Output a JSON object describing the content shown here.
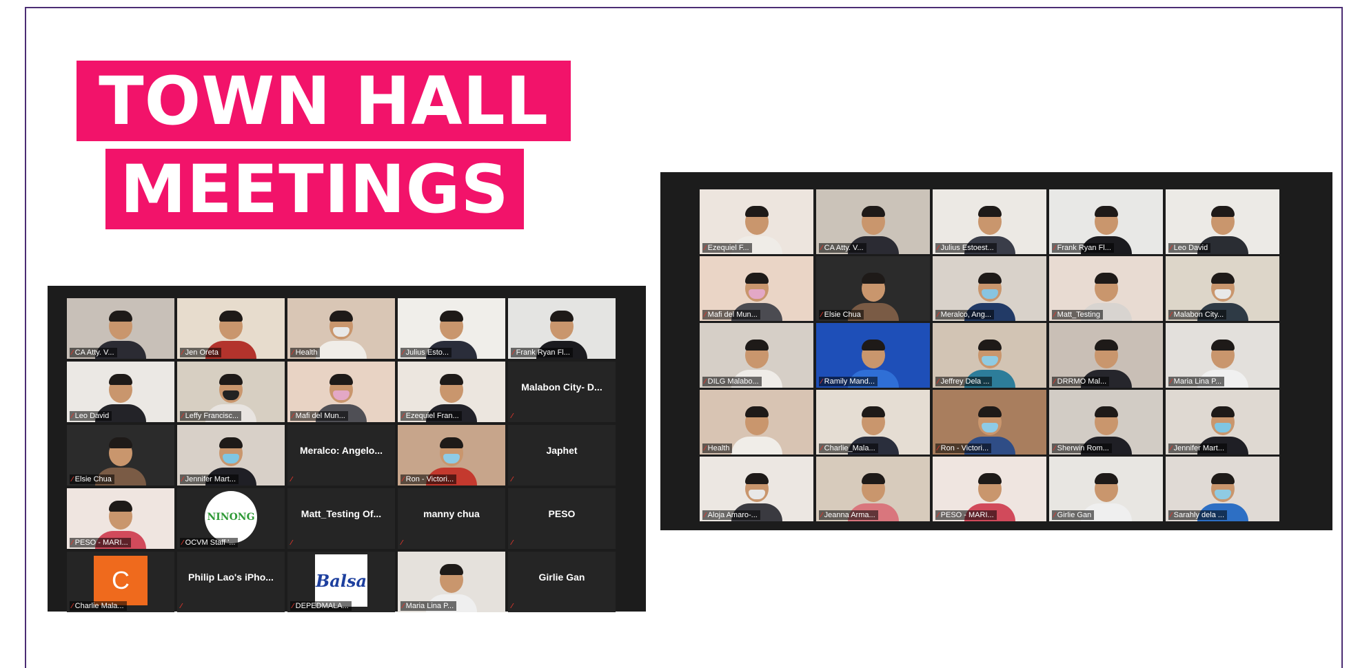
{
  "title": {
    "line1": "TOWN HALL",
    "line2": "MEETINGS"
  },
  "colors": {
    "brand_pink": "#f2136a",
    "frame": "#4b2d73",
    "active_border": "#d6e05a",
    "mic_off": "#e0352b"
  },
  "left_gallery": [
    {
      "name": "CA Atty. V...",
      "kind": "video",
      "bg": "#c8c0b8",
      "shirt": "#2b2b33"
    },
    {
      "name": "Jen Oreta",
      "kind": "video",
      "bg": "#e7dccd",
      "shirt": "#b3332c"
    },
    {
      "name": "Health",
      "kind": "video",
      "bg": "#d9c6b5",
      "shirt": "#f0ede8",
      "mask": "#e8e8e8"
    },
    {
      "name": "Julius Esto...",
      "kind": "video",
      "bg": "#f0eeea",
      "shirt": "#2a2d3a"
    },
    {
      "name": "Frank Ryan Fl...",
      "kind": "video",
      "bg": "#e4e4e2",
      "shirt": "#1b1b1f"
    },
    {
      "name": "Leo David",
      "kind": "video",
      "bg": "#ebe8e4",
      "shirt": "#232328"
    },
    {
      "name": "Leffy Francisc...",
      "kind": "video",
      "bg": "#d7cfc2",
      "shirt": "#e8e4e0",
      "mask": "#222"
    },
    {
      "name": "Mafi del Mun...",
      "kind": "video",
      "bg": "#e8d3c4",
      "shirt": "#4f4f55",
      "mask": "#e3a8c6"
    },
    {
      "name": "Ezequiel Fran...",
      "kind": "video",
      "bg": "#ece6df",
      "shirt": "#222229"
    },
    {
      "name": "Malabon City- D...",
      "kind": "text"
    },
    {
      "name": "Elsie Chua",
      "kind": "video",
      "bg": "#2b2b2b",
      "shirt": "#7a5b45",
      "active": true
    },
    {
      "name": "Jennifer Mart...",
      "kind": "video",
      "bg": "#d8d0c8",
      "shirt": "#1f1f25",
      "mask": "#7fc6e3"
    },
    {
      "name": "Meralco: Angelo...",
      "kind": "text"
    },
    {
      "name": "Ron - Victori...",
      "kind": "video",
      "bg": "#c7a58b",
      "shirt": "#c4392e",
      "mask": "#8ecbe6"
    },
    {
      "name": "Japhet",
      "kind": "text"
    },
    {
      "name": "PESO - MARI...",
      "kind": "video",
      "bg": "#efe5e0",
      "shirt": "#d14a5b"
    },
    {
      "name": "OCVM Staff '...",
      "kind": "logo",
      "logo_text": "NINONG",
      "logo_color": "#2f9a37"
    },
    {
      "name": "Matt_Testing Of...",
      "kind": "text"
    },
    {
      "name": "manny chua",
      "kind": "text"
    },
    {
      "name": "PESO",
      "kind": "text"
    },
    {
      "name": "Charlie Mala...",
      "kind": "avatar",
      "letter": "C"
    },
    {
      "name": "Philip Lao's iPho...",
      "kind": "text"
    },
    {
      "name": "DEPEDMALA...",
      "kind": "logo",
      "logo_text": "Balsa",
      "logo_color": "#1d3f9e"
    },
    {
      "name": "Maria Lina P...",
      "kind": "video",
      "bg": "#e5e1dc",
      "shirt": "#efefef"
    },
    {
      "name": "Girlie Gan",
      "kind": "text"
    }
  ],
  "right_gallery": [
    {
      "name": "Ezequiel F...",
      "kind": "video",
      "bg": "#ede5de",
      "shirt": "#efece7"
    },
    {
      "name": "CA Atty. V...",
      "kind": "video",
      "bg": "#cbc3b9",
      "shirt": "#2b2b33"
    },
    {
      "name": "Julius Estoest...",
      "kind": "video",
      "bg": "#ece9e4",
      "shirt": "#3a3d49",
      "active": true
    },
    {
      "name": "Frank Ryan Fl...",
      "kind": "video",
      "bg": "#e8e8e6",
      "shirt": "#1b1b1f"
    },
    {
      "name": "Leo David",
      "kind": "video",
      "bg": "#eceae6",
      "shirt": "#2a2d33"
    },
    {
      "name": "Mafi del Mun...",
      "kind": "video",
      "bg": "#ead5c6",
      "shirt": "#4b4b51",
      "mask": "#e3a8c6"
    },
    {
      "name": "Elsie Chua",
      "kind": "video",
      "bg": "#2b2b2b",
      "shirt": "#7a5b45"
    },
    {
      "name": "Meralco, Ang...",
      "kind": "video",
      "bg": "#d9d2ca",
      "shirt": "#223a66",
      "mask": "#88c4e0"
    },
    {
      "name": "Matt_Testing",
      "kind": "video",
      "bg": "#e8dbd2",
      "shirt": "#d8d4d0"
    },
    {
      "name": "Malabon City...",
      "kind": "video",
      "bg": "#ddd6c9",
      "shirt": "#2e3a45",
      "mask": "#e8e8e8"
    },
    {
      "name": "DILG Malabo...",
      "kind": "video",
      "bg": "#d6cfc7",
      "shirt": "#efece8"
    },
    {
      "name": "Ramily Mand...",
      "kind": "video",
      "bg": "#1e4fb8",
      "shirt": "#2f6fd6"
    },
    {
      "name": "Jeffrey Dela ...",
      "kind": "video",
      "bg": "#d2c4b4",
      "shirt": "#2d7d9a",
      "mask": "#8fcbe3"
    },
    {
      "name": "DRRMO Mal...",
      "kind": "video",
      "bg": "#c9bfb6",
      "shirt": "#26262c"
    },
    {
      "name": "Maria Lina P...",
      "kind": "video",
      "bg": "#e3e0dc",
      "shirt": "#f0f0f0"
    },
    {
      "name": "Health",
      "kind": "video",
      "bg": "#d8c4b3",
      "shirt": "#f0ede8"
    },
    {
      "name": "Charlie_Mala...",
      "kind": "video",
      "bg": "#e5ddd3",
      "shirt": "#2a2e3c"
    },
    {
      "name": "Ron - Victori...",
      "kind": "video",
      "bg": "#a97e5e",
      "shirt": "#2f4d86",
      "mask": "#8ecbe6"
    },
    {
      "name": "Sherwin Rom...",
      "kind": "video",
      "bg": "#d2ccc5",
      "shirt": "#1f1f25"
    },
    {
      "name": "Jennifer Mart...",
      "kind": "video",
      "bg": "#dfd9d2",
      "shirt": "#1f1f25",
      "mask": "#7fc6e3"
    },
    {
      "name": "Aloja Amaro-...",
      "kind": "video",
      "bg": "#ece7e2",
      "shirt": "#3a3a40",
      "mask": "#e8e8e8"
    },
    {
      "name": "Jeanna Arma...",
      "kind": "video",
      "bg": "#d7cbbc",
      "shirt": "#d9767d"
    },
    {
      "name": "PESO - MARI...",
      "kind": "video",
      "bg": "#efe5e0",
      "shirt": "#d14a5b"
    },
    {
      "name": "Girlie Gan",
      "kind": "video",
      "bg": "#e8e6e2",
      "shirt": "#efefef"
    },
    {
      "name": "Sarahly dela ...",
      "kind": "video",
      "bg": "#e0dad5",
      "shirt": "#2d6fc4",
      "mask": "#8fcbe3"
    }
  ]
}
